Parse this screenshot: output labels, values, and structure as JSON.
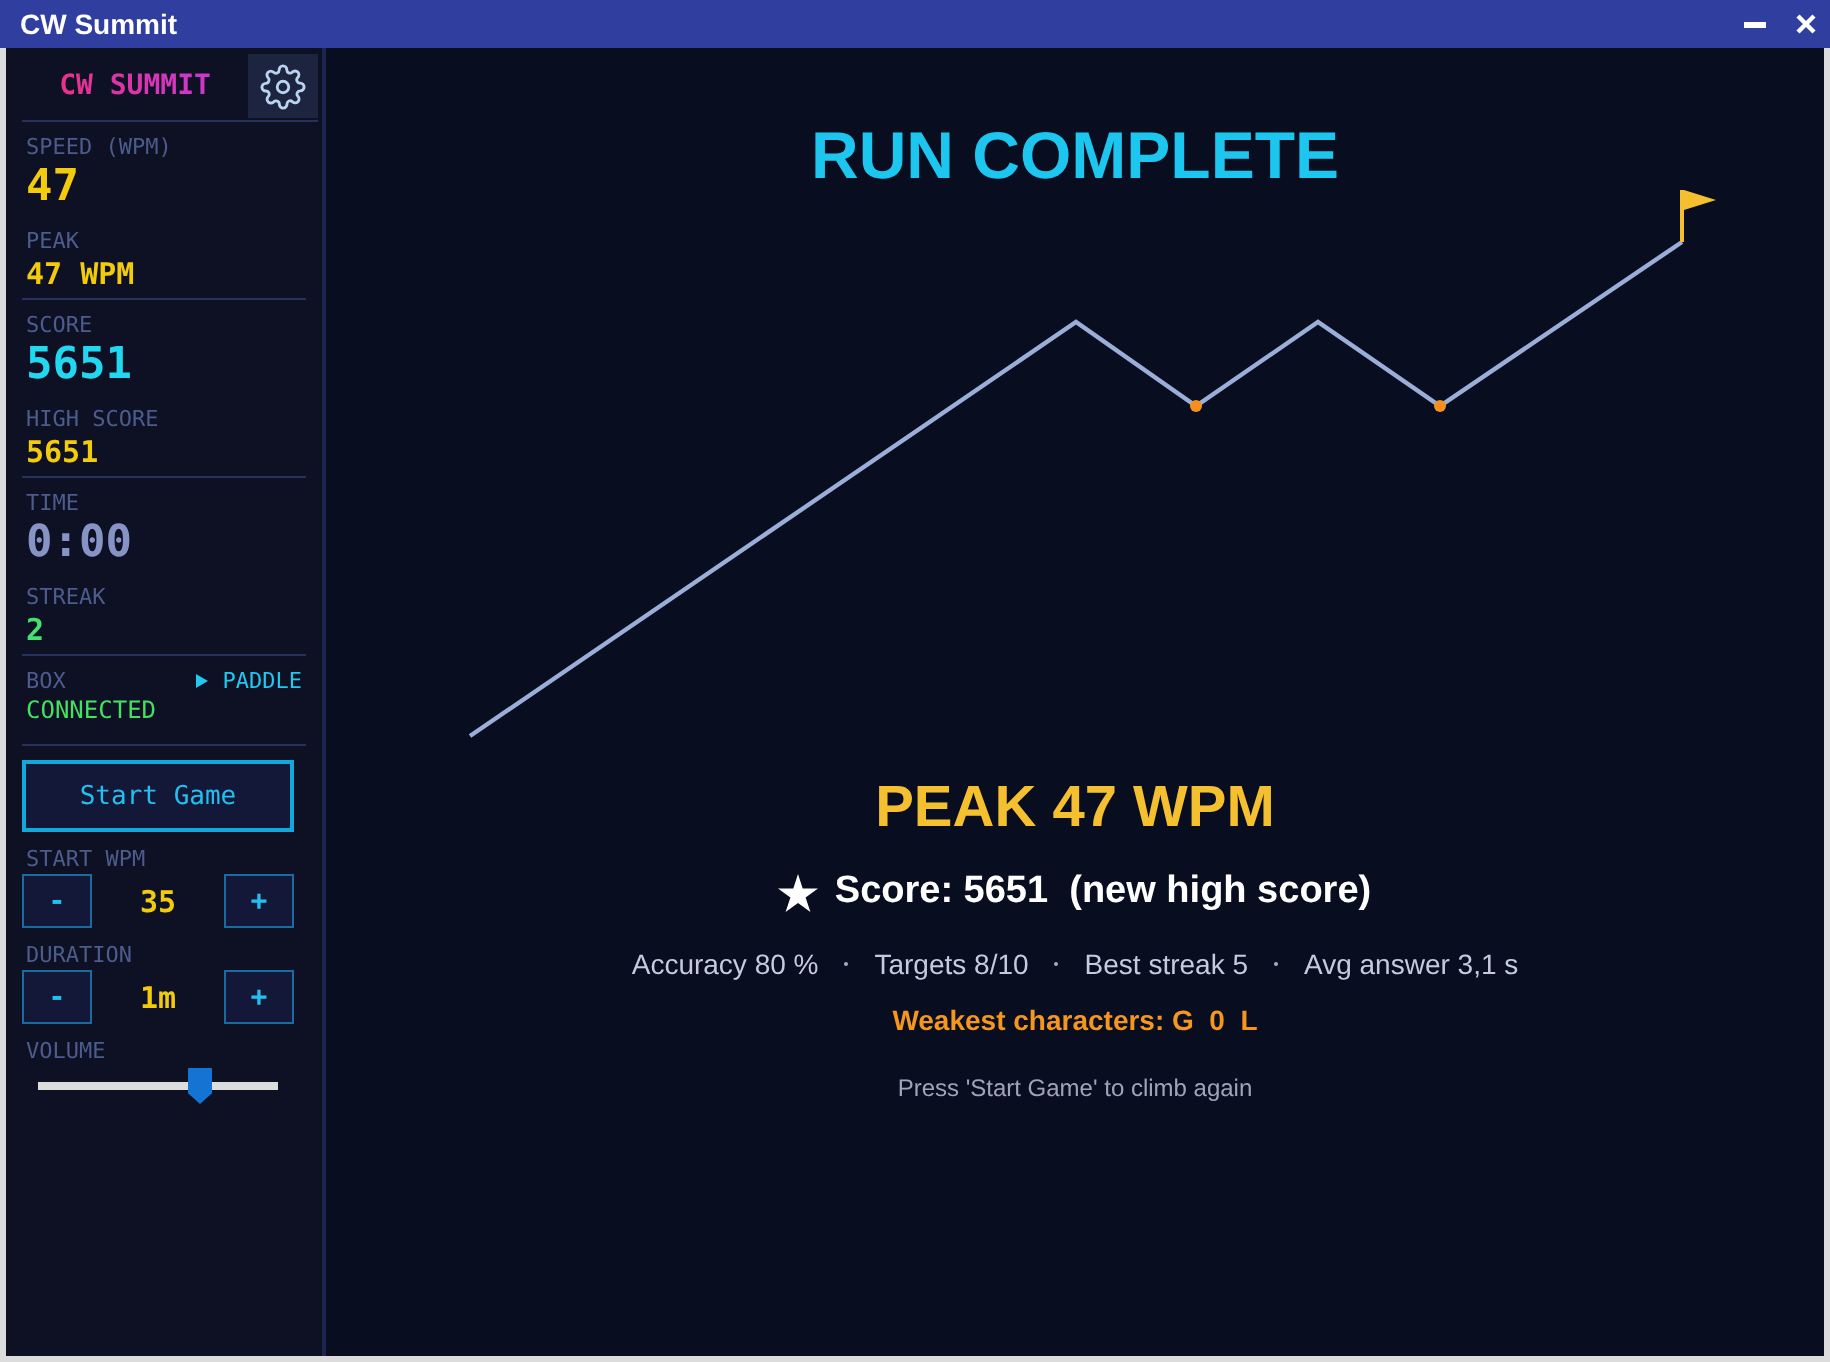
{
  "window": {
    "title": "CW Summit"
  },
  "sidebar": {
    "title": "CW SUMMIT",
    "sections": [
      {
        "stats": [
          {
            "label": "SPEED (WPM)",
            "value": "47",
            "kind": "large",
            "color": "#f2cc0c"
          },
          {
            "label": "PEAK",
            "value": "47 WPM",
            "kind": "small",
            "color": "#f2cc0c"
          }
        ]
      },
      {
        "stats": [
          {
            "label": "SCORE",
            "value": "5651",
            "kind": "large",
            "color": "#22d8f0"
          },
          {
            "label": "HIGH SCORE",
            "value": "5651",
            "kind": "small",
            "color": "#f2cc0c"
          }
        ]
      },
      {
        "stats": [
          {
            "label": "TIME",
            "value": "0:00",
            "kind": "large",
            "color": "#8594c4"
          },
          {
            "label": "STREAK",
            "value": "2",
            "kind": "small",
            "color": "#44e070"
          }
        ]
      }
    ],
    "box": {
      "label": "BOX",
      "input": "PADDLE",
      "status": "CONNECTED",
      "connected": true
    },
    "start_button": "Start Game",
    "steppers": [
      {
        "label": "START WPM",
        "decrement": "-",
        "value": "35",
        "increment": "+"
      },
      {
        "label": "DURATION",
        "decrement": "-",
        "value": "1m",
        "increment": "+"
      }
    ],
    "volume": {
      "label": "VOLUME",
      "level": 0.675
    }
  },
  "results": {
    "title": "RUN COMPLETE",
    "peak": "PEAK 47 WPM",
    "new_high_score": true,
    "score": "Score: 5651  (new high score)",
    "stats": [
      "Accuracy 80 %",
      "Targets 8/10",
      "Best streak 5",
      "Avg answer 3,1 s"
    ],
    "weakest": "Weakest characters: G  0  L",
    "hint": "Press 'Start Game' to climb again"
  }
}
